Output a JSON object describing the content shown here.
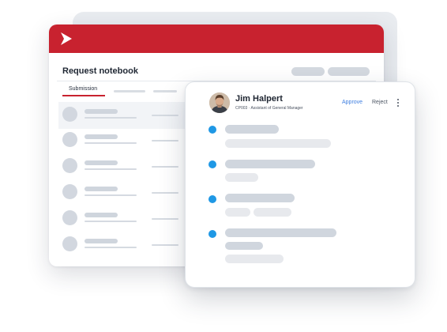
{
  "notebook": {
    "title": "Request notebook",
    "tabs": [
      {
        "label": "Submission",
        "active": true
      },
      {
        "label": "",
        "active": false
      },
      {
        "label": "",
        "active": false
      }
    ],
    "row_count": 6,
    "selected_row": 0
  },
  "detail": {
    "name": "Jim Halpert",
    "subtitle": "CP003 · Assistant of General Manager",
    "approve_label": "Approve",
    "reject_label": "Reject",
    "timeline_items": 4
  },
  "colors": {
    "brand_red": "#c8222f",
    "accent_blue": "#1f98e5",
    "approve_blue": "#3d7ee0"
  },
  "icons": [
    "logo-chevron-icon",
    "more-vertical-icon"
  ]
}
